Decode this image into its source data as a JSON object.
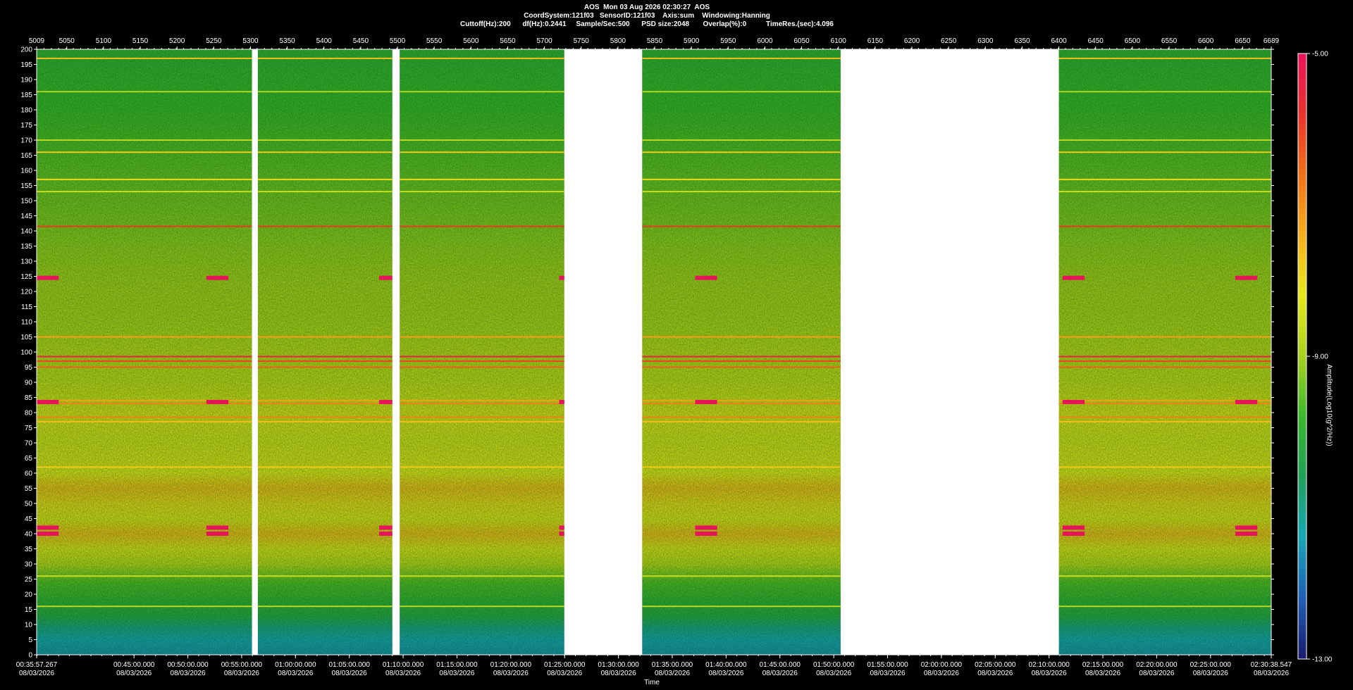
{
  "header": {
    "line1": "AOS  Mon 03 Aug 2026 02:30:27  AOS",
    "line2": "CoordSystem:121f03   SensorID:121f03    Axis:sum    Windowing:Hanning",
    "line3": "Cuttoff(Hz):200      df(Hz):0.2441     Sample/Sec:500      PSD size:2048       Overlap(%):0          TimeRes.(sec):4.096"
  },
  "chart_data": {
    "type": "heatmap",
    "title": "AOS  Mon 03 Aug 2026 02:30:27  AOS",
    "xlabel": "Time",
    "ylabel": "",
    "x_top_range": [
      5009,
      6689
    ],
    "x_top_ticks": [
      "5009",
      "5050",
      "5100",
      "5150",
      "5200",
      "5250",
      "5300",
      "5350",
      "5400",
      "5450",
      "5500",
      "5550",
      "5600",
      "5650",
      "5700",
      "5750",
      "5800",
      "5850",
      "5900",
      "5950",
      "6000",
      "6050",
      "6100",
      "6150",
      "6200",
      "6250",
      "6300",
      "6350",
      "6400",
      "6450",
      "6500",
      "6550",
      "6600",
      "6650",
      "6689"
    ],
    "x_bottom_ticks": [
      {
        "time": "00:35:57.267",
        "date": "08/03/2026"
      },
      {
        "time": "00:45:00.000",
        "date": "08/03/2026"
      },
      {
        "time": "00:50:00.000",
        "date": "08/03/2026"
      },
      {
        "time": "00:55:00.000",
        "date": "08/03/2026"
      },
      {
        "time": "01:00:00.000",
        "date": "08/03/2026"
      },
      {
        "time": "01:05:00.000",
        "date": "08/03/2026"
      },
      {
        "time": "01:10:00.000",
        "date": "08/03/2026"
      },
      {
        "time": "01:15:00.000",
        "date": "08/03/2026"
      },
      {
        "time": "01:20:00.000",
        "date": "08/03/2026"
      },
      {
        "time": "01:25:00.000",
        "date": "08/03/2026"
      },
      {
        "time": "01:30:00.000",
        "date": "08/03/2026"
      },
      {
        "time": "01:35:00.000",
        "date": "08/03/2026"
      },
      {
        "time": "01:40:00.000",
        "date": "08/03/2026"
      },
      {
        "time": "01:45:00.000",
        "date": "08/03/2026"
      },
      {
        "time": "01:50:00.000",
        "date": "08/03/2026"
      },
      {
        "time": "01:55:00.000",
        "date": "08/03/2026"
      },
      {
        "time": "02:00:00.000",
        "date": "08/03/2026"
      },
      {
        "time": "02:05:00.000",
        "date": "08/03/2026"
      },
      {
        "time": "02:10:00.000",
        "date": "08/03/2026"
      },
      {
        "time": "02:15:00.000",
        "date": "08/03/2026"
      },
      {
        "time": "02:20:00.000",
        "date": "08/03/2026"
      },
      {
        "time": "02:25:00.000",
        "date": "08/03/2026"
      },
      {
        "time": "02:30:38.547",
        "date": "08/03/2026"
      }
    ],
    "x_bottom_range_sec": [
      2157.267,
      9038.547
    ],
    "y_range_hz": [
      0,
      200
    ],
    "y_ticks": [
      0,
      5,
      10,
      15,
      20,
      25,
      30,
      35,
      40,
      45,
      50,
      55,
      60,
      65,
      70,
      75,
      80,
      85,
      90,
      95,
      100,
      105,
      110,
      115,
      120,
      125,
      130,
      135,
      140,
      145,
      150,
      155,
      160,
      165,
      170,
      175,
      180,
      185,
      190,
      195,
      200
    ],
    "colorbar": {
      "label": "Amplitude(Log10(g^2/Hz))",
      "range": [
        -13.0,
        -5.0
      ],
      "tick_labels": [
        "-5.00",
        "-9.00",
        "-13.00"
      ],
      "colors": [
        "#1a1a6e",
        "#1e5fb4",
        "#17a6b8",
        "#1fa05a",
        "#3ab82c",
        "#a8d21e",
        "#e8e81c",
        "#f6b01c",
        "#f07018",
        "#e8322a",
        "#e8145a"
      ]
    },
    "data_segments_top_units": [
      [
        5009,
        5302
      ],
      [
        5310,
        5493
      ],
      [
        5503,
        5727
      ],
      [
        5833,
        6103
      ],
      [
        6400,
        6689
      ]
    ],
    "spectrum_profile": [
      {
        "hz": 0,
        "level": -11.6
      },
      {
        "hz": 5,
        "level": -11.4
      },
      {
        "hz": 9,
        "level": -11.0
      },
      {
        "hz": 13,
        "level": -10.3
      },
      {
        "hz": 18,
        "level": -10.0
      },
      {
        "hz": 24,
        "level": -9.6
      },
      {
        "hz": 30,
        "level": -8.7
      },
      {
        "hz": 35,
        "level": -8.3
      },
      {
        "hz": 40,
        "level": -7.6
      },
      {
        "hz": 45,
        "level": -8.3
      },
      {
        "hz": 50,
        "level": -8.0
      },
      {
        "hz": 55,
        "level": -7.6
      },
      {
        "hz": 60,
        "level": -8.2
      },
      {
        "hz": 70,
        "level": -8.4
      },
      {
        "hz": 80,
        "level": -8.3
      },
      {
        "hz": 90,
        "level": -8.6
      },
      {
        "hz": 100,
        "level": -8.7
      },
      {
        "hz": 110,
        "level": -8.9
      },
      {
        "hz": 125,
        "level": -9.0
      },
      {
        "hz": 140,
        "level": -9.2
      },
      {
        "hz": 160,
        "level": -9.5
      },
      {
        "hz": 180,
        "level": -9.8
      },
      {
        "hz": 200,
        "level": -10.0
      }
    ],
    "tonal_lines": [
      {
        "hz": 197,
        "level": -7.6
      },
      {
        "hz": 186,
        "level": -8.9
      },
      {
        "hz": 170,
        "level": -8.8
      },
      {
        "hz": 166,
        "level": -7.8
      },
      {
        "hz": 157,
        "level": -8.0
      },
      {
        "hz": 153,
        "level": -8.6
      },
      {
        "hz": 141.5,
        "level": -5.9
      },
      {
        "hz": 105,
        "level": -7.2
      },
      {
        "hz": 98.5,
        "level": -5.4
      },
      {
        "hz": 97,
        "level": -6.0
      },
      {
        "hz": 95,
        "level": -6.4
      },
      {
        "hz": 84,
        "level": -7.2
      },
      {
        "hz": 83,
        "level": -6.8
      },
      {
        "hz": 78.5,
        "level": -6.8
      },
      {
        "hz": 77,
        "level": -7.6
      },
      {
        "hz": 62,
        "level": -7.8
      },
      {
        "hz": 26,
        "level": -8.6
      },
      {
        "hz": 16,
        "level": -8.8
      }
    ],
    "burst_windows_top_units": [
      5009,
      5240,
      5475,
      5720,
      5905,
      6405,
      6640
    ],
    "burst_lines_hz": [
      124.5,
      83.5,
      42,
      40
    ]
  }
}
